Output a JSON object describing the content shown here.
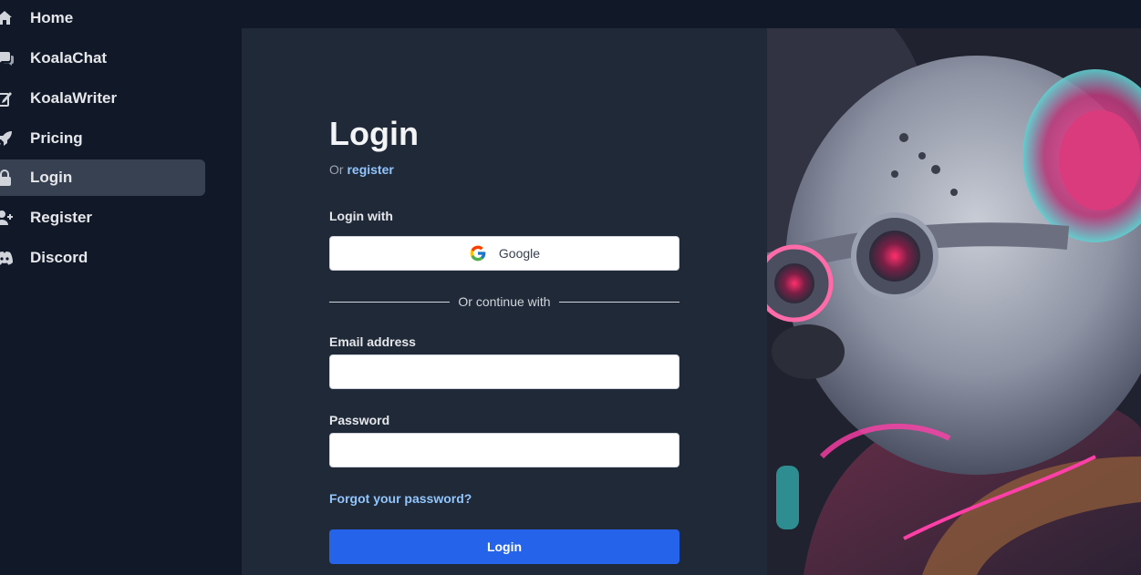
{
  "sidebar": {
    "items": [
      {
        "label": "Home",
        "icon": "home-icon",
        "active": false
      },
      {
        "label": "KoalaChat",
        "icon": "chat-icon",
        "active": false
      },
      {
        "label": "KoalaWriter",
        "icon": "pencil-icon",
        "active": false
      },
      {
        "label": "Pricing",
        "icon": "rocket-icon",
        "active": false
      },
      {
        "label": "Login",
        "icon": "lock-icon",
        "active": true
      },
      {
        "label": "Register",
        "icon": "user-plus-icon",
        "active": false
      },
      {
        "label": "Discord",
        "icon": "discord-icon",
        "active": false
      }
    ]
  },
  "login": {
    "title": "Login",
    "or_text": "Or",
    "register_link": "register",
    "login_with": "Login with",
    "google_label": "Google",
    "divider_text": "Or continue with",
    "email_label": "Email address",
    "email_value": "",
    "password_label": "Password",
    "password_value": "",
    "forgot_link": "Forgot your password?",
    "submit_label": "Login"
  },
  "colors": {
    "sidebar_bg": "#111827",
    "panel_bg": "#1f2937",
    "active_item_bg": "#374151",
    "link": "#93c5fd",
    "primary_button": "#2563eb"
  }
}
